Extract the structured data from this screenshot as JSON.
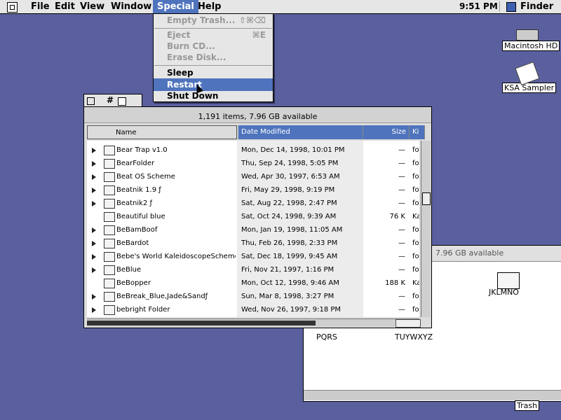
{
  "menubar": {
    "items": [
      "File",
      "Edit",
      "View",
      "Window",
      "Special",
      "Help"
    ],
    "time": "9:51 PM",
    "app": "Finder"
  },
  "special_menu": {
    "items": [
      {
        "label": "Empty Trash...",
        "shortcut": "⇧⌘⌫",
        "enabled": false
      },
      {
        "label": "Eject",
        "shortcut": "⌘E",
        "enabled": false
      },
      {
        "label": "Burn CD...",
        "shortcut": "",
        "enabled": false
      },
      {
        "label": "Erase Disk...",
        "shortcut": "",
        "enabled": false
      },
      {
        "label": "Sleep",
        "shortcut": "",
        "enabled": true
      },
      {
        "label": "Restart",
        "shortcut": "",
        "enabled": true,
        "highlighted": true
      },
      {
        "label": "Shut Down",
        "shortcut": "",
        "enabled": true
      }
    ]
  },
  "desktop": {
    "icons": [
      {
        "label": "Macintosh HD",
        "icon": "hard-disk-icon"
      },
      {
        "label": "KSA Sampler",
        "icon": "paint-icon"
      },
      {
        "label": "Trash",
        "icon": "trash-icon"
      }
    ]
  },
  "back_window": {
    "header": "7.96 GB available",
    "folders": [
      "JKLMNO",
      "PQRS",
      "TUYWXYZ"
    ]
  },
  "front_window": {
    "title": "#",
    "status": "1,191 items, 7.96 GB available",
    "columns": [
      "Name",
      "Date Modified",
      "Size",
      "Ki"
    ],
    "rows": [
      {
        "name": "Bear Trap v1.0",
        "date": "Mon, Dec 14, 1998, 10:01 PM",
        "size": "—",
        "kind": "fol",
        "folder": true
      },
      {
        "name": "BearFolder",
        "date": "Thu, Sep 24, 1998, 5:05 PM",
        "size": "—",
        "kind": "fol",
        "folder": true
      },
      {
        "name": "Beat OS Scheme",
        "date": "Wed, Apr 30, 1997, 6:53 AM",
        "size": "—",
        "kind": "fol",
        "folder": true
      },
      {
        "name": "Beatnik 1.9 ƒ",
        "date": "Fri, May 29, 1998, 9:19 PM",
        "size": "—",
        "kind": "fol",
        "folder": true
      },
      {
        "name": "Beatnik2 ƒ",
        "date": "Sat, Aug 22, 1998, 2:47 PM",
        "size": "—",
        "kind": "fol",
        "folder": true
      },
      {
        "name": "Beautiful blue",
        "date": "Sat, Oct 24, 1998, 9:39 AM",
        "size": "76 K",
        "kind": "Ka",
        "folder": false
      },
      {
        "name": "BeBamBoof",
        "date": "Mon, Jan 19, 1998, 11:05 AM",
        "size": "—",
        "kind": "fol",
        "folder": true
      },
      {
        "name": "BeBardot",
        "date": "Thu, Feb 26, 1998, 2:33 PM",
        "size": "—",
        "kind": "fol",
        "folder": true
      },
      {
        "name": "Bebe's World KaleidoscopeScheme",
        "date": "Sat, Dec 18, 1999, 9:45 AM",
        "size": "—",
        "kind": "fol",
        "folder": true
      },
      {
        "name": "BeBlue",
        "date": "Fri, Nov 21, 1997, 1:16 PM",
        "size": "—",
        "kind": "fol",
        "folder": true
      },
      {
        "name": "BeBopper",
        "date": "Mon, Oct 12, 1998, 9:46 AM",
        "size": "188 K",
        "kind": "Ka",
        "folder": false
      },
      {
        "name": "BeBreak_Blue,Jade&Sandƒ",
        "date": "Sun, Mar 8, 1998, 3:27 PM",
        "size": "—",
        "kind": "fol",
        "folder": true
      },
      {
        "name": "bebright Folder",
        "date": "Wed, Nov 26, 1997, 9:18 PM",
        "size": "—",
        "kind": "fol",
        "folder": true
      }
    ]
  }
}
